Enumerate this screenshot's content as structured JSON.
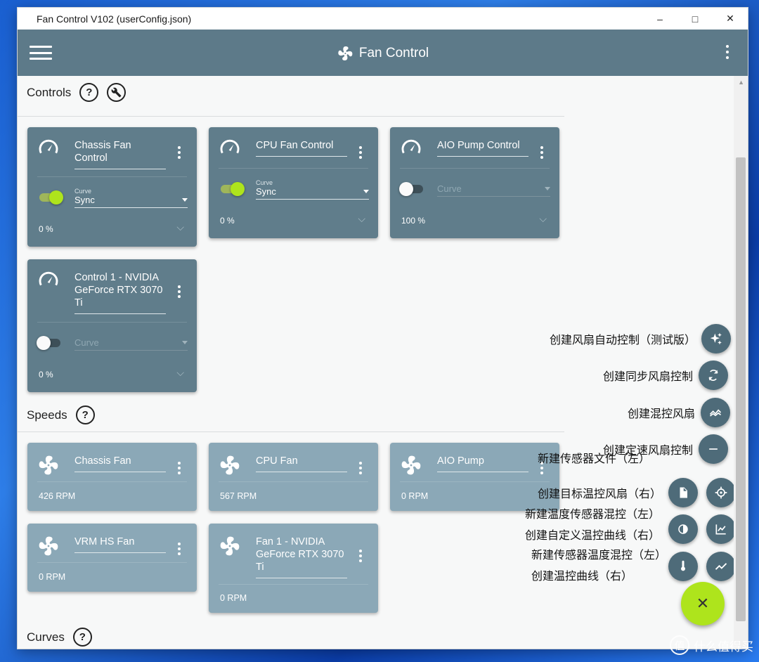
{
  "window": {
    "title": "Fan Control V102 (userConfig.json)",
    "minimize": "–",
    "maximize": "□",
    "close": "✕"
  },
  "appbar": {
    "title": "Fan Control",
    "menu_icon": "hamburger-icon",
    "more_icon": "kebab-icon"
  },
  "sections": {
    "controls": "Controls",
    "speeds": "Speeds",
    "curves": "Curves",
    "help_glyph": "?"
  },
  "controls": [
    {
      "name": "Chassis Fan Control",
      "enabled": true,
      "curve_label": "Curve",
      "curve": "Sync",
      "percent": "0 %"
    },
    {
      "name": "CPU Fan Control",
      "enabled": true,
      "curve_label": "Curve",
      "curve": "Sync",
      "percent": "0 %"
    },
    {
      "name": "AIO Pump Control",
      "enabled": false,
      "curve_label": "",
      "curve": "Curve",
      "percent": "100 %"
    },
    {
      "name": "Control 1 - NVIDIA GeForce RTX 3070 Ti",
      "enabled": false,
      "curve_label": "",
      "curve": "Curve",
      "percent": "0 %"
    }
  ],
  "speeds": [
    {
      "name": "Chassis Fan",
      "rpm": "426 RPM"
    },
    {
      "name": "CPU Fan",
      "rpm": "567 RPM"
    },
    {
      "name": "AIO Pump",
      "rpm": "0 RPM"
    },
    {
      "name": "VRM HS Fan",
      "rpm": "0 RPM"
    },
    {
      "name": "Fan 1 - NVIDIA GeForce RTX 3070 Ti",
      "rpm": "0 RPM"
    }
  ],
  "fab_menu": {
    "auto_control": "创建风扇自动控制（测试版）",
    "sync_control": "创建同步风扇控制",
    "mix_fan": "创建混控风扇",
    "fixed_speed": "创建定速风扇控制",
    "new_sensor_file": "新建传感器文件（左）",
    "target_temp_fan": "创建目标温控风扇（右）",
    "temp_sensor_mix": "新建温度传感器混控（左）",
    "custom_curve": "创建自定义温控曲线（右）",
    "sensor_temp_mix": "新建传感器温度混控（左）",
    "temp_curve": "创建温控曲线（右）",
    "close_glyph": "✕"
  },
  "watermark": {
    "text": "什么值得买",
    "glyph": "值"
  },
  "colors": {
    "appbar": "#5d7a89",
    "card": "#607d8b",
    "speed_card": "#8ba8b7",
    "accent": "#aee41c"
  }
}
